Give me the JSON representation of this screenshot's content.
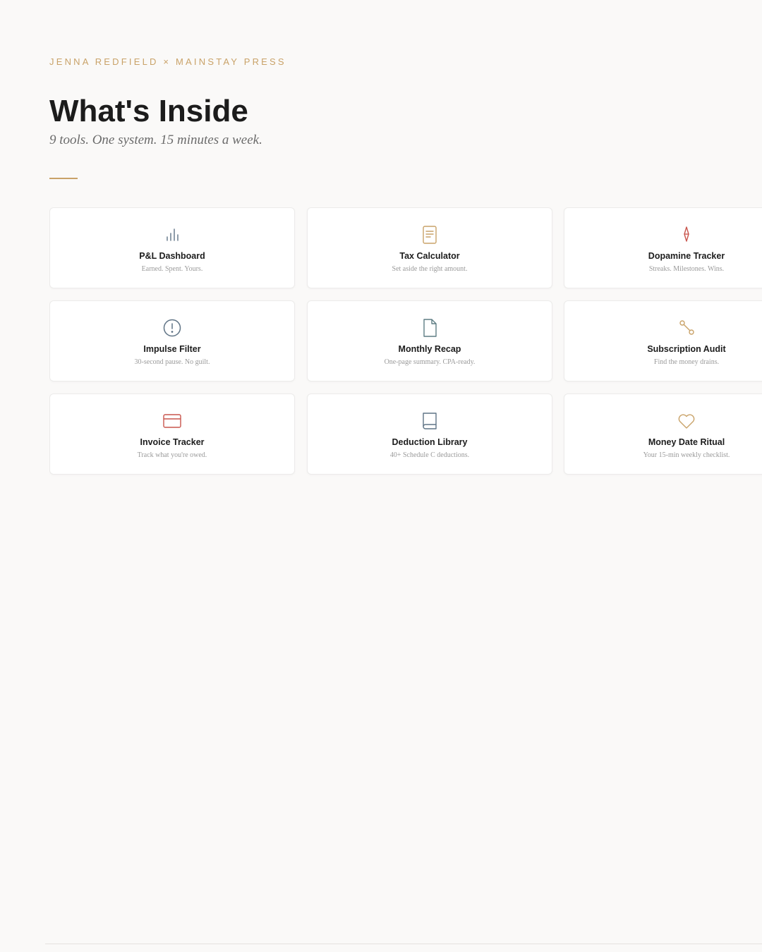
{
  "header": {
    "eyebrow": "JENNA REDFIELD × MAINSTAY PRESS",
    "title": "What's Inside",
    "subtitle": "9 tools. One system. 15 minutes a week."
  },
  "colors": {
    "accent_gold": "#c9a268",
    "slate_blue": "#5f7385",
    "teal_gray": "#5e7d84",
    "coral_red": "#c9554d",
    "background": "#faf9f8"
  },
  "tools": [
    {
      "title": "P&L Dashboard",
      "desc": "Earned. Spent. Yours.",
      "icon": "bar-chart-icon"
    },
    {
      "title": "Tax Calculator",
      "desc": "Set aside the right amount.",
      "icon": "receipt-icon"
    },
    {
      "title": "Dopamine Tracker",
      "desc": "Streaks. Milestones. Wins.",
      "icon": "sparkle-icon"
    },
    {
      "title": "Impulse Filter",
      "desc": "30-second pause. No guilt.",
      "icon": "alert-circle-icon"
    },
    {
      "title": "Monthly Recap",
      "desc": "One-page summary. CPA-ready.",
      "icon": "document-icon"
    },
    {
      "title": "Subscription Audit",
      "desc": "Find the money drains.",
      "icon": "link-nodes-icon"
    },
    {
      "title": "Invoice Tracker",
      "desc": "Track what you're owed.",
      "icon": "credit-card-icon"
    },
    {
      "title": "Deduction Library",
      "desc": "40+ Schedule C deductions.",
      "icon": "book-icon"
    },
    {
      "title": "Money Date Ritual",
      "desc": "Your 15-min weekly checklist.",
      "icon": "heart-icon"
    }
  ]
}
